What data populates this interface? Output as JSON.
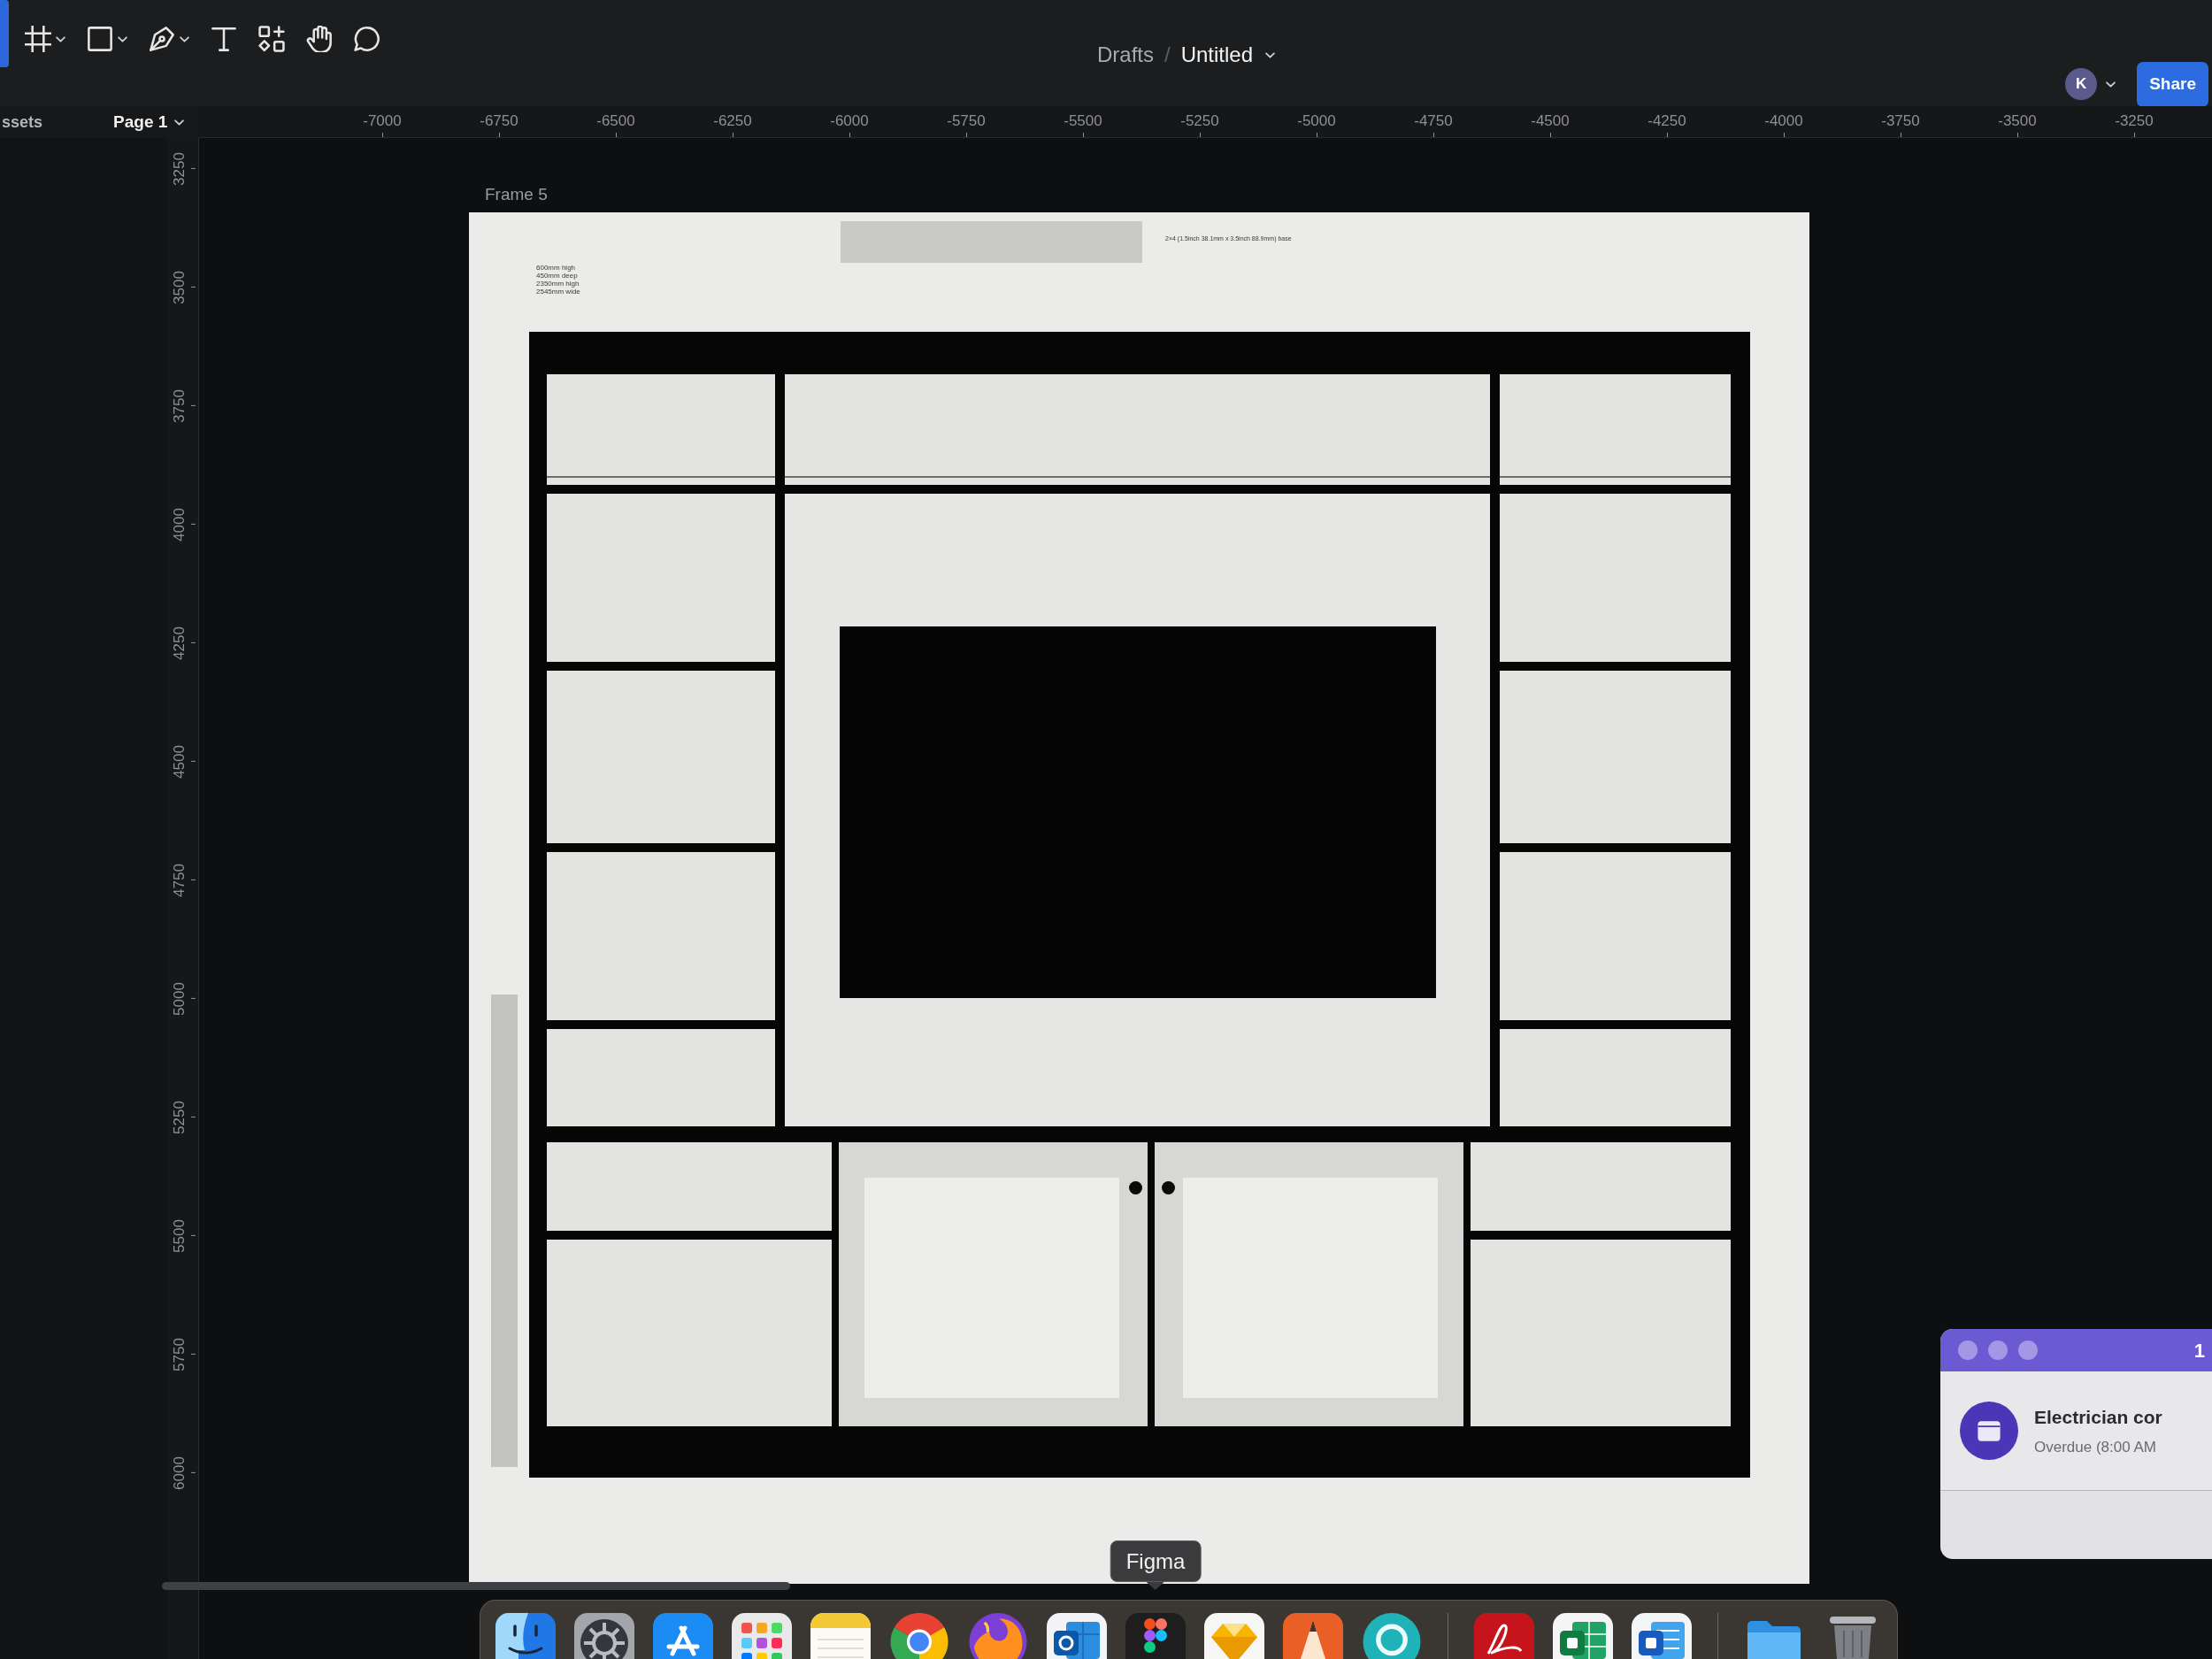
{
  "toolbar": {
    "tools": [
      {
        "kind": "frame",
        "menu": true
      },
      {
        "kind": "shape",
        "menu": true
      },
      {
        "kind": "pen",
        "menu": true
      },
      {
        "kind": "text",
        "menu": false
      },
      {
        "kind": "resources",
        "menu": false
      },
      {
        "kind": "hand",
        "menu": false
      },
      {
        "kind": "comment",
        "menu": false
      }
    ]
  },
  "breadcrumb": {
    "folder": "Drafts",
    "separator": "/",
    "file": "Untitled"
  },
  "account": {
    "initial": "K"
  },
  "share_button": "Share",
  "left_panel": {
    "tab": "ssets",
    "page": "Page 1"
  },
  "horizontal_ruler": [
    "-7000",
    "-6750",
    "-6500",
    "-6250",
    "-6000",
    "-5750",
    "-5500",
    "-5250",
    "-5000",
    "-4750",
    "-4500",
    "-4250",
    "-4000",
    "-3750",
    "-3500",
    "-3250"
  ],
  "vertical_ruler": [
    "3250",
    "3500",
    "3750",
    "4000",
    "4250",
    "4500",
    "4750",
    "5000",
    "5250",
    "5500",
    "5750",
    "6000"
  ],
  "canvas": {
    "frame": {
      "label": "Frame 5",
      "dimension_notes": [
        "600mm high",
        "450mm deep",
        "2350mm high",
        "2545mm wide"
      ],
      "base_note": "2×4 (1.5inch 38.1mm x 3.5inch 88.9mm) base"
    }
  },
  "notification": {
    "header": "1",
    "title": "Electrician cor",
    "subtitle": "Overdue (8:00 AM"
  },
  "dock": {
    "items": [
      {
        "kind": "face"
      },
      {
        "kind": "gear"
      },
      {
        "kind": "strokes"
      },
      {
        "kind": "grid"
      },
      {
        "kind": "notepad"
      },
      {
        "kind": "segments"
      },
      {
        "kind": "flame"
      },
      {
        "kind": "tiles"
      },
      {
        "kind": "shapes",
        "tooltip": "Figma"
      },
      {
        "kind": "gem"
      },
      {
        "kind": "pencil"
      },
      {
        "kind": "ring"
      },
      {
        "kind": "separator"
      },
      {
        "kind": "swirl"
      },
      {
        "kind": "sheet"
      },
      {
        "kind": "doc"
      },
      {
        "kind": "separator"
      },
      {
        "kind": "folder"
      },
      {
        "kind": "trash"
      }
    ]
  }
}
